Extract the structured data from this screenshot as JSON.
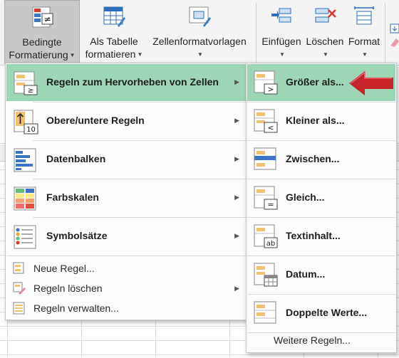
{
  "ribbon": {
    "buttons": [
      {
        "line1": "Bedingte",
        "line2": "Formatierung",
        "icon": "conditional-formatting-icon"
      },
      {
        "line1": "Als Tabelle",
        "line2": "formatieren",
        "icon": "format-as-table-icon"
      },
      {
        "line1": "Zellenformatvorlagen",
        "line2": "",
        "icon": "cell-styles-icon"
      },
      {
        "line1": "Einfügen",
        "line2": "",
        "icon": "insert-cells-icon"
      },
      {
        "line1": "Löschen",
        "line2": "",
        "icon": "delete-cells-icon"
      },
      {
        "line1": "Format",
        "line2": "",
        "icon": "format-cells-icon"
      }
    ]
  },
  "menu": {
    "items": [
      {
        "label": "Regeln zum Hervorheben von Zellen",
        "mnemonic": "H",
        "icon": "highlight-cells-rules-icon"
      },
      {
        "label": "Obere/untere Regeln",
        "mnemonic": "O",
        "icon": "top-bottom-rules-icon"
      },
      {
        "label": "Datenbalken",
        "mnemonic": "D",
        "icon": "data-bars-icon"
      },
      {
        "label": "Farbskalen",
        "mnemonic": "F",
        "icon": "color-scales-icon"
      },
      {
        "label": "Symbolsätze",
        "mnemonic": "S",
        "icon": "icon-sets-icon"
      }
    ],
    "small_items": [
      {
        "label": "Neue Regel...",
        "mnemonic": "N",
        "icon": "new-rule-icon"
      },
      {
        "label": "Regeln löschen",
        "mnemonic": "l",
        "icon": "clear-rules-icon"
      },
      {
        "label": "Regeln verwalten...",
        "mnemonic": "R",
        "icon": "manage-rules-icon"
      }
    ],
    "top_icon_number": "10"
  },
  "submenu": {
    "items": [
      {
        "label": "Größer als...",
        "mnemonic": "G",
        "icon": "greater-than-icon",
        "symbol": ">"
      },
      {
        "label": "Kleiner als...",
        "mnemonic": "K",
        "icon": "less-than-icon",
        "symbol": "<"
      },
      {
        "label": "Zwischen...",
        "mnemonic": "Z",
        "icon": "between-icon",
        "symbol": ""
      },
      {
        "label": "Gleich...",
        "mnemonic": "G",
        "icon": "equal-to-icon",
        "symbol": "="
      },
      {
        "label": "Textinhalt...",
        "mnemonic": "T",
        "icon": "text-contains-icon",
        "symbol": "ab"
      },
      {
        "label": "Datum...",
        "mnemonic": "D",
        "icon": "date-occurring-icon",
        "symbol": ""
      },
      {
        "label": "Doppelte Werte...",
        "mnemonic": "D",
        "icon": "duplicate-values-icon",
        "symbol": ""
      }
    ],
    "more": {
      "label": "Weitere Regeln...",
      "mnemonic": "W"
    }
  },
  "colors": {
    "highlight": "#9fd5b7",
    "arrow": "#c8222a",
    "accent_blue": "#2f6ebe",
    "accent_orange": "#f0c171"
  }
}
